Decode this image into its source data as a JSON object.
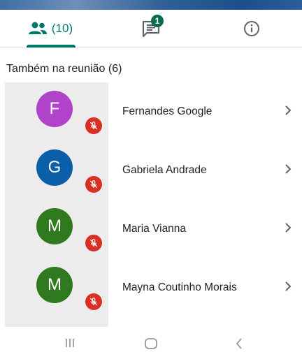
{
  "tabs": {
    "people_count": "(10)",
    "chat_badge": "1"
  },
  "section_title": "Também na reunião (6)",
  "participants": [
    {
      "initial": "F",
      "name": "Fernandes Google",
      "color": "#b043c9"
    },
    {
      "initial": "G",
      "name": "Gabriela Andrade",
      "color": "#0b5ea8"
    },
    {
      "initial": "M",
      "name": "Maria Vianna",
      "color": "#2f7a1f"
    },
    {
      "initial": "M",
      "name": "Mayna Coutinho Morais",
      "color": "#2f7a1f"
    }
  ],
  "colors": {
    "accent": "#00796b",
    "mute": "#d93025"
  },
  "icons": [
    "people-icon",
    "chat-icon",
    "info-icon",
    "mic-off-icon",
    "chevron-right-icon",
    "recents-icon",
    "home-icon",
    "back-icon"
  ]
}
